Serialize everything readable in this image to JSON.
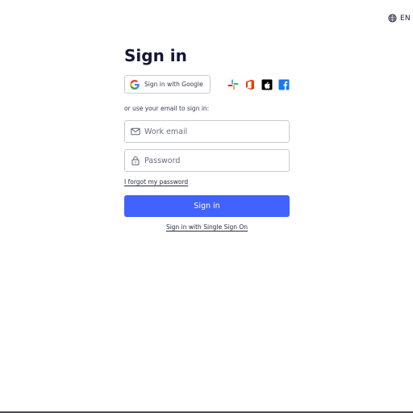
{
  "header": {
    "language_code": "EN",
    "language_icon": "globe-icon"
  },
  "form": {
    "title": "Sign in",
    "google_button_label": "Sign in with Google",
    "google_icon": "google-icon",
    "providers": [
      {
        "name": "Slack",
        "icon": "slack-icon"
      },
      {
        "name": "Office 365",
        "icon": "office-icon"
      },
      {
        "name": "Apple",
        "icon": "apple-icon"
      },
      {
        "name": "Facebook",
        "icon": "facebook-icon"
      }
    ],
    "divider_text": "or use your email to sign in:",
    "email": {
      "placeholder": "Work email",
      "value": "",
      "icon": "mail-icon"
    },
    "password": {
      "placeholder": "Password",
      "value": "",
      "icon": "lock-icon"
    },
    "forgot_password_link": "I forgot my password",
    "submit_label": "Sign in",
    "sso_link": "Sign in with Single Sign On"
  },
  "colors": {
    "primary_button": "#4262ff",
    "title_text": "#15153a",
    "input_border": "#c9cbd4"
  }
}
